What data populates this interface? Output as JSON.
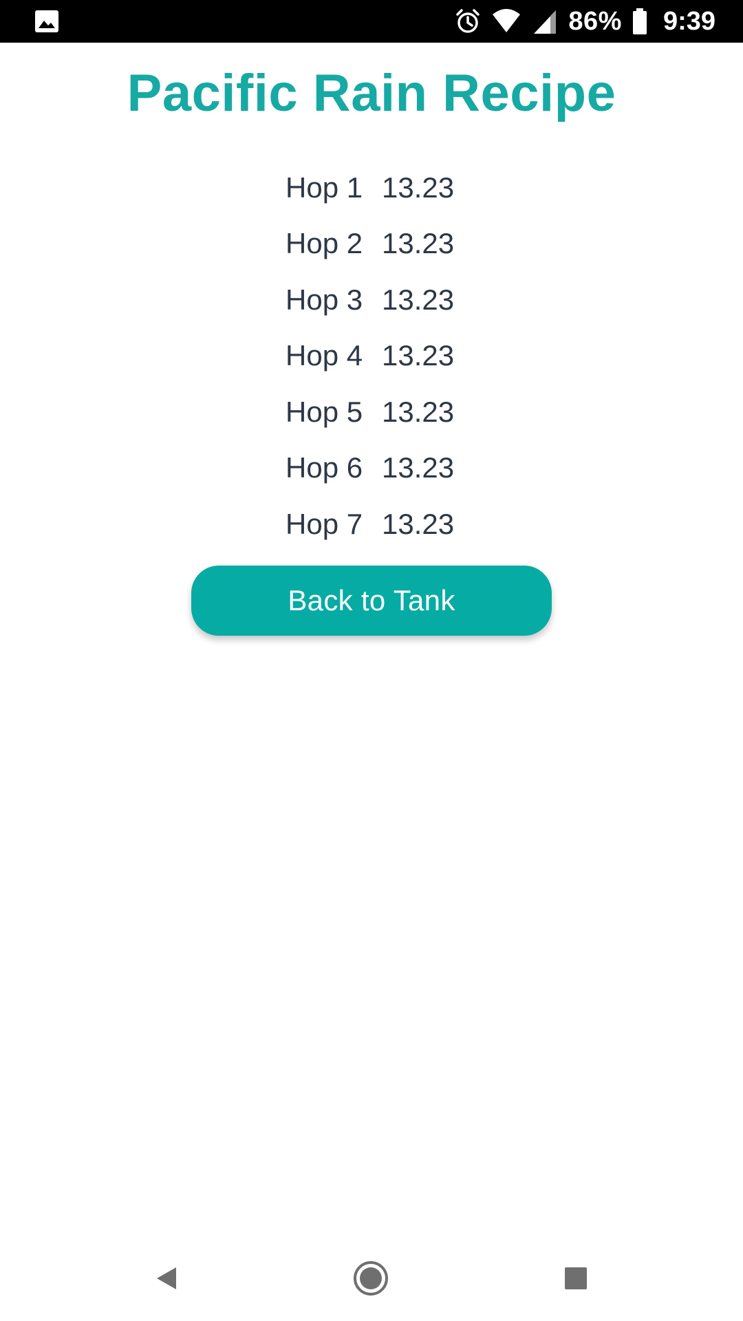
{
  "status_bar": {
    "left_icon": "image-icon",
    "icons": [
      "alarm-icon",
      "wifi-icon",
      "signal-icon",
      "battery-icon"
    ],
    "battery_percent": "86%",
    "time": "9:39"
  },
  "page": {
    "title": "Pacific Rain Recipe",
    "title_color": "#17a9a4"
  },
  "hops": [
    {
      "name": "Hop 1",
      "value": "13.23"
    },
    {
      "name": "Hop 2",
      "value": "13.23"
    },
    {
      "name": "Hop 3",
      "value": "13.23"
    },
    {
      "name": "Hop 4",
      "value": "13.23"
    },
    {
      "name": "Hop 5",
      "value": "13.23"
    },
    {
      "name": "Hop 6",
      "value": "13.23"
    },
    {
      "name": "Hop 7",
      "value": "13.23"
    }
  ],
  "actions": {
    "back_label": "Back to Tank",
    "button_color": "#06aca3"
  },
  "nav_bar": {
    "icons": [
      "back-triangle-icon",
      "home-circle-icon",
      "recents-square-icon"
    ]
  }
}
